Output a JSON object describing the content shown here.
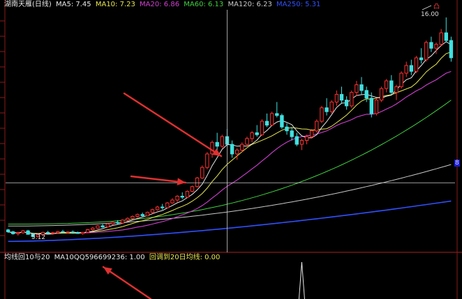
{
  "window": {
    "stock_title": "湖南天雁(日线)"
  },
  "ma_legend": [
    {
      "label": "MA5: 7.45",
      "color": "#e8e8e8"
    },
    {
      "label": "MA10: 7.23",
      "color": "#e8e850"
    },
    {
      "label": "MA20: 6.86",
      "color": "#d040d0"
    },
    {
      "label": "MA60: 6.13",
      "color": "#40d040"
    },
    {
      "label": "MA120: 6.23",
      "color": "#c8c8c8"
    },
    {
      "label": "MA250: 5.31",
      "color": "#3050ff"
    }
  ],
  "indicator_legend": [
    {
      "label": "均线回10与20",
      "color": "#e8e8e8"
    },
    {
      "label": "MA10QQ596699236: 1.00",
      "color": "#e8e8e8"
    },
    {
      "label": "回调到20日均线: 0.00",
      "color": "#e8e850"
    }
  ],
  "price_labels": {
    "high": "16.00",
    "low": "5.12",
    "high_marker": "凸",
    "right_axis": "8"
  },
  "colors": {
    "up_candle": "#ff3030",
    "down_candle": "#40e0e0",
    "crosshair": "#cccccc",
    "arrow": "#e03030",
    "panel_border": "#8b1a1a",
    "title": "#e8e8e8"
  },
  "candles": [
    [
      5.55,
      5.6,
      5.4,
      5.45
    ],
    [
      5.45,
      5.5,
      5.3,
      5.35
    ],
    [
      5.35,
      5.45,
      5.25,
      5.4
    ],
    [
      5.4,
      5.55,
      5.35,
      5.5
    ],
    [
      5.5,
      5.55,
      5.3,
      5.32
    ],
    [
      5.32,
      5.4,
      5.12,
      5.2
    ],
    [
      5.2,
      5.35,
      5.15,
      5.3
    ],
    [
      5.3,
      5.45,
      5.25,
      5.42
    ],
    [
      5.42,
      5.5,
      5.35,
      5.38
    ],
    [
      5.38,
      5.45,
      5.3,
      5.4
    ],
    [
      5.4,
      5.5,
      5.35,
      5.46
    ],
    [
      5.46,
      5.55,
      5.4,
      5.42
    ],
    [
      5.42,
      5.48,
      5.36,
      5.44
    ],
    [
      5.44,
      5.52,
      5.38,
      5.4
    ],
    [
      5.4,
      5.46,
      5.34,
      5.36
    ],
    [
      5.36,
      5.44,
      5.3,
      5.42
    ],
    [
      5.42,
      5.6,
      5.4,
      5.56
    ],
    [
      5.56,
      5.7,
      5.5,
      5.64
    ],
    [
      5.64,
      5.8,
      5.6,
      5.76
    ],
    [
      5.76,
      5.85,
      5.66,
      5.7
    ],
    [
      5.7,
      5.9,
      5.68,
      5.86
    ],
    [
      5.86,
      6.0,
      5.8,
      5.94
    ],
    [
      5.94,
      6.05,
      5.85,
      5.9
    ],
    [
      5.9,
      6.1,
      5.88,
      6.06
    ],
    [
      6.06,
      6.2,
      6.0,
      6.15
    ],
    [
      6.15,
      6.3,
      6.1,
      6.25
    ],
    [
      6.25,
      6.4,
      6.18,
      6.35
    ],
    [
      6.35,
      6.45,
      6.2,
      6.28
    ],
    [
      6.28,
      6.5,
      6.25,
      6.46
    ],
    [
      6.46,
      6.65,
      6.4,
      6.6
    ],
    [
      6.6,
      6.8,
      6.55,
      6.74
    ],
    [
      6.74,
      6.9,
      6.6,
      6.7
    ],
    [
      6.7,
      7.0,
      6.68,
      6.95
    ],
    [
      6.95,
      7.2,
      6.9,
      7.1
    ],
    [
      7.1,
      7.35,
      7.0,
      7.3
    ],
    [
      7.3,
      7.5,
      7.15,
      7.25
    ],
    [
      7.25,
      7.6,
      7.2,
      7.55
    ],
    [
      7.55,
      7.85,
      7.5,
      7.8
    ],
    [
      7.8,
      8.3,
      7.75,
      8.25
    ],
    [
      8.25,
      8.9,
      8.2,
      8.8
    ],
    [
      8.8,
      9.6,
      8.7,
      9.5
    ],
    [
      9.5,
      10.2,
      9.3,
      10.1
    ],
    [
      10.1,
      10.6,
      9.7,
      9.9
    ],
    [
      9.9,
      10.5,
      9.8,
      10.4
    ],
    [
      10.4,
      10.8,
      9.9,
      10.0
    ],
    [
      10.0,
      10.2,
      9.3,
      9.5
    ],
    [
      9.5,
      9.8,
      9.2,
      9.7
    ],
    [
      9.7,
      10.1,
      9.6,
      10.0
    ],
    [
      10.0,
      10.4,
      9.9,
      10.3
    ],
    [
      10.3,
      10.7,
      10.1,
      10.6
    ],
    [
      10.6,
      11.0,
      10.4,
      10.5
    ],
    [
      10.5,
      11.3,
      10.45,
      11.2
    ],
    [
      11.2,
      11.6,
      10.9,
      11.0
    ],
    [
      11.0,
      11.7,
      10.95,
      11.6
    ],
    [
      11.6,
      12.2,
      11.4,
      11.5
    ],
    [
      11.5,
      11.6,
      10.8,
      10.9
    ],
    [
      10.9,
      11.1,
      10.5,
      10.7
    ],
    [
      10.7,
      10.9,
      10.2,
      10.4
    ],
    [
      10.4,
      10.6,
      9.9,
      10.0
    ],
    [
      10.0,
      10.3,
      9.7,
      10.2
    ],
    [
      10.2,
      10.5,
      10.0,
      10.4
    ],
    [
      10.4,
      10.8,
      10.3,
      10.7
    ],
    [
      10.7,
      11.3,
      10.6,
      11.2
    ],
    [
      11.2,
      12.0,
      11.1,
      11.9
    ],
    [
      11.9,
      12.4,
      11.5,
      11.7
    ],
    [
      11.7,
      12.3,
      11.6,
      12.2
    ],
    [
      12.2,
      12.8,
      12.0,
      12.6
    ],
    [
      12.6,
      13.0,
      12.1,
      12.3
    ],
    [
      12.3,
      12.5,
      11.8,
      12.0
    ],
    [
      12.0,
      12.8,
      11.9,
      12.7
    ],
    [
      12.7,
      13.3,
      12.5,
      13.1
    ],
    [
      13.1,
      13.5,
      12.6,
      12.8
    ],
    [
      12.8,
      13.0,
      12.2,
      12.4
    ],
    [
      12.4,
      12.7,
      11.4,
      11.6
    ],
    [
      11.6,
      12.4,
      11.5,
      12.3
    ],
    [
      12.3,
      13.0,
      12.2,
      12.9
    ],
    [
      12.9,
      13.4,
      12.7,
      13.3
    ],
    [
      13.3,
      13.6,
      12.6,
      12.7
    ],
    [
      12.7,
      13.1,
      12.3,
      13.0
    ],
    [
      13.0,
      13.8,
      12.9,
      13.7
    ],
    [
      13.7,
      14.3,
      13.5,
      14.1
    ],
    [
      14.1,
      14.4,
      13.6,
      13.8
    ],
    [
      13.8,
      14.6,
      13.7,
      14.5
    ],
    [
      14.5,
      15.0,
      14.2,
      14.4
    ],
    [
      14.4,
      15.4,
      14.3,
      15.3
    ],
    [
      15.3,
      15.6,
      14.8,
      15.0
    ],
    [
      15.0,
      15.3,
      14.7,
      15.2
    ],
    [
      15.2,
      16.0,
      15.1,
      15.8
    ],
    [
      15.8,
      16.6,
      15.3,
      15.4
    ],
    [
      15.4,
      15.6,
      14.3,
      14.5
    ]
  ],
  "indicator_spike_index": 59
}
